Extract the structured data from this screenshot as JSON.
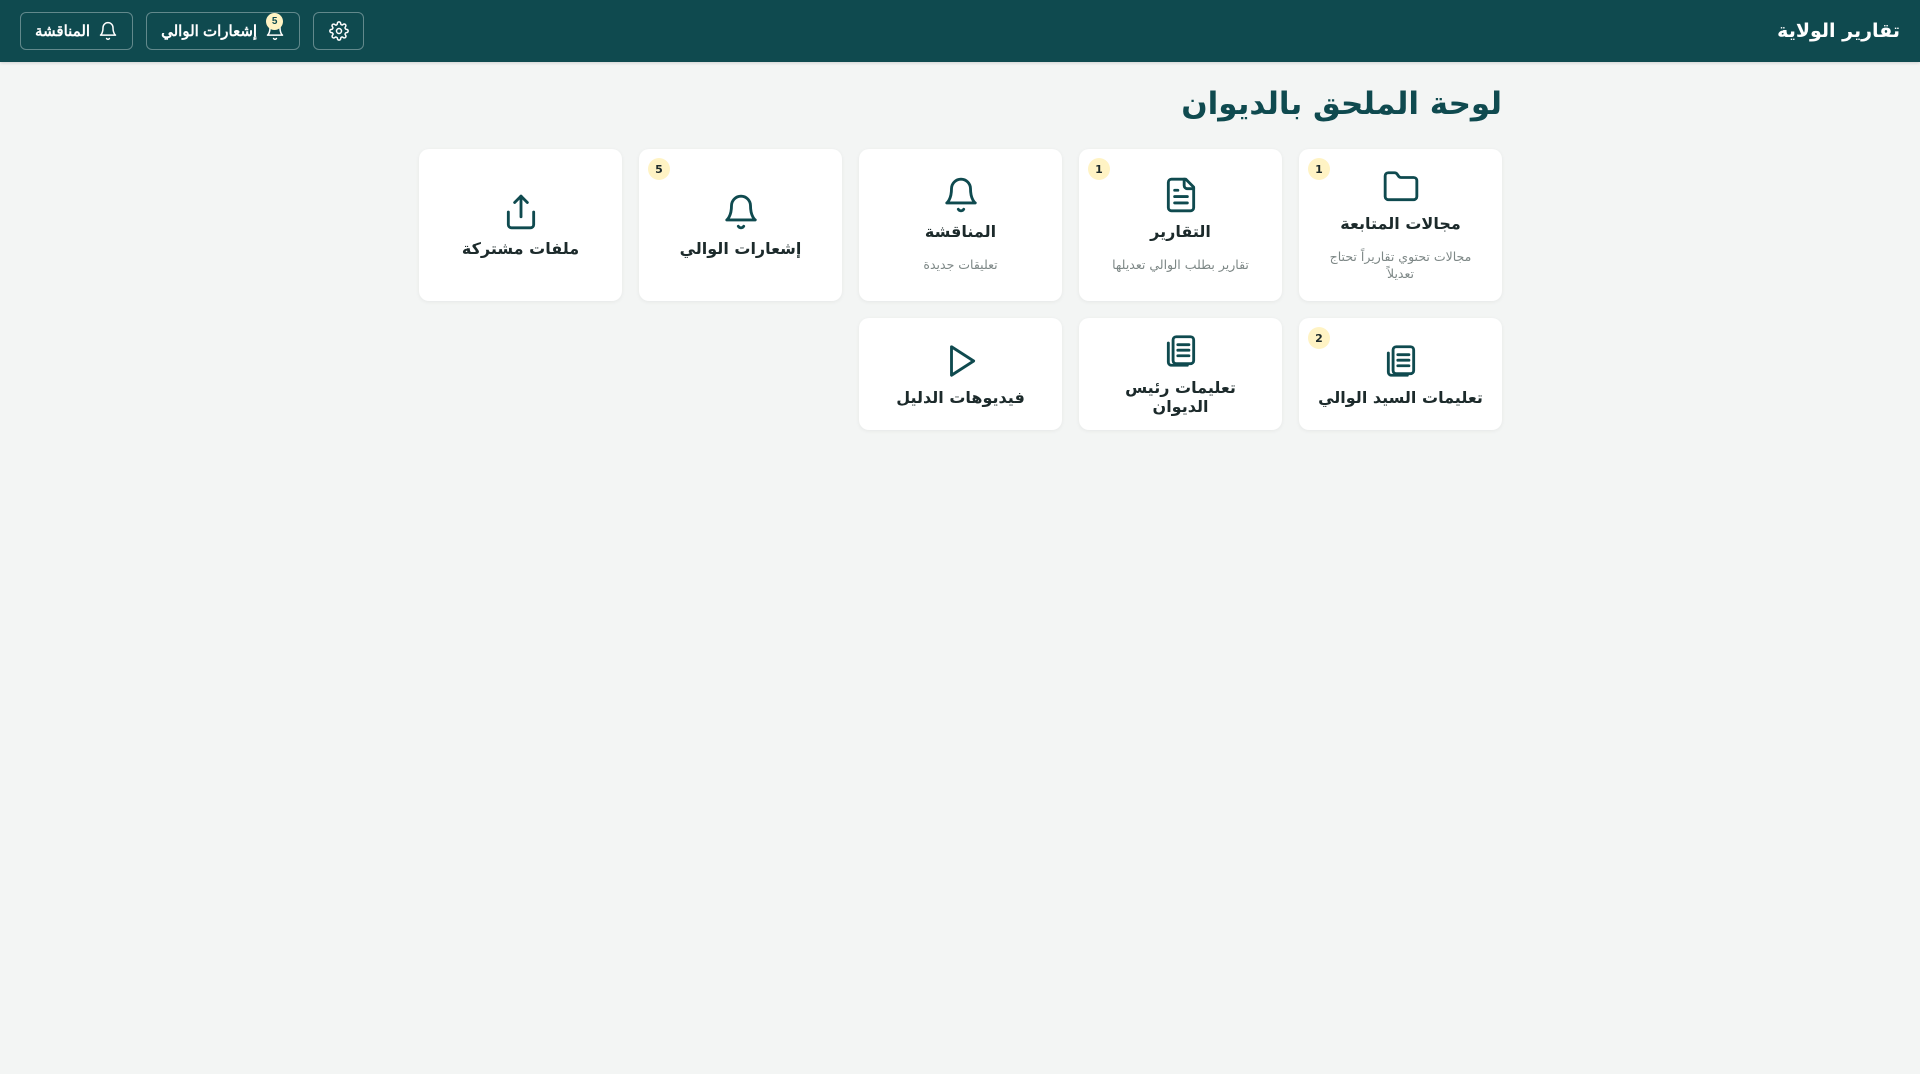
{
  "app": {
    "title": "تقارير الولاية"
  },
  "topbar": {
    "settings_icon": "gear-icon",
    "discussion_button": {
      "label": "المناقشة",
      "icon": "bell-icon"
    },
    "governor_notifications_button": {
      "label": "إشعارات الوالي",
      "icon": "bell-icon",
      "badge": "5"
    }
  },
  "page": {
    "title": "لوحة الملحق بالديوان"
  },
  "cards": [
    {
      "title": "مجالات المتابعة",
      "subtitle": "مجالات تحتوي تقاريراً تحتاج تعديلاً",
      "badge": "1",
      "icon": "folder-icon"
    },
    {
      "title": "التقارير",
      "subtitle": "تقارير بطلب الوالي تعديلها",
      "badge": "1",
      "icon": "document-icon"
    },
    {
      "title": "المناقشة",
      "subtitle": "تعليقات جديدة",
      "badge": "",
      "icon": "bell-icon"
    },
    {
      "title": "إشعارات الوالي",
      "subtitle": "",
      "badge": "5",
      "icon": "bell-icon"
    },
    {
      "title": "ملفات مشتركة",
      "subtitle": "",
      "badge": "",
      "icon": "share-upload-icon"
    },
    {
      "title": "تعليمات السيد الوالي",
      "subtitle": "",
      "badge": "2",
      "icon": "documents-icon"
    },
    {
      "title": "تعليمات رئيس الديوان",
      "subtitle": "",
      "badge": "",
      "icon": "documents-icon"
    },
    {
      "title": "فيديوهات الدليل",
      "subtitle": "",
      "badge": "",
      "icon": "play-icon"
    }
  ],
  "colors": {
    "primary": "#0f4a4f",
    "background": "#f3f5f4",
    "badge": "#fff3c4"
  }
}
